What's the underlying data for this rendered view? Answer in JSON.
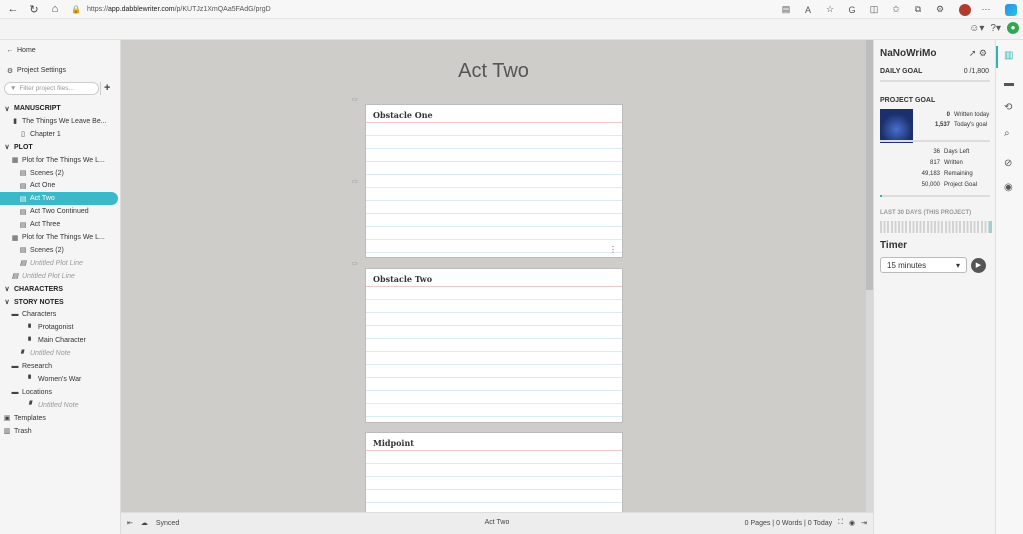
{
  "browser": {
    "url_prefix": "https://",
    "url_host": "app.dabblewriter.com",
    "url_path": "/p/KUTJz1XmQAa5FAdG/prgD"
  },
  "sidebar": {
    "home": "Home",
    "settings": "Project Settings",
    "filter_placeholder": "Filter project files...",
    "add": "+",
    "rows": [
      {
        "label": "MANUSCRIPT",
        "indent": 0,
        "kind": "sec",
        "icon": "v"
      },
      {
        "label": "The Things We Leave Be...",
        "indent": 1,
        "kind": "item",
        "icon": "book"
      },
      {
        "label": "Chapter 1",
        "indent": 2,
        "kind": "item",
        "icon": "chapter"
      },
      {
        "label": "PLOT",
        "indent": 0,
        "kind": "sec",
        "icon": "v"
      },
      {
        "label": "Plot for The Things We L...",
        "indent": 1,
        "kind": "item",
        "icon": "grid"
      },
      {
        "label": "Scenes  (2)",
        "indent": 2,
        "kind": "item",
        "icon": "line"
      },
      {
        "label": "Act One",
        "indent": 2,
        "kind": "item",
        "icon": "line"
      },
      {
        "label": "Act Two",
        "indent": 2,
        "kind": "active",
        "icon": "line"
      },
      {
        "label": "Act Two Continued",
        "indent": 2,
        "kind": "item",
        "icon": "line"
      },
      {
        "label": "Act Three",
        "indent": 2,
        "kind": "item",
        "icon": "line"
      },
      {
        "label": "Plot for The Things We L...",
        "indent": 1,
        "kind": "item",
        "icon": "grid"
      },
      {
        "label": "Scenes  (2)",
        "indent": 2,
        "kind": "item",
        "icon": "line"
      },
      {
        "label": "Untitled Plot Line",
        "indent": 2,
        "kind": "muted",
        "icon": "line"
      },
      {
        "label": "Untitled Plot Line",
        "indent": 1,
        "kind": "muted",
        "icon": "line"
      },
      {
        "label": "CHARACTERS",
        "indent": 0,
        "kind": "sec",
        "icon": "v"
      },
      {
        "label": "STORY NOTES",
        "indent": 0,
        "kind": "sec",
        "icon": "v"
      },
      {
        "label": "Characters",
        "indent": 1,
        "kind": "item",
        "icon": "folder"
      },
      {
        "label": "Protagonist",
        "indent": 3,
        "kind": "item",
        "icon": "note"
      },
      {
        "label": "Main Character",
        "indent": 3,
        "kind": "item",
        "icon": "note"
      },
      {
        "label": "Untitled Note",
        "indent": 2,
        "kind": "muted",
        "icon": "note"
      },
      {
        "label": "Research",
        "indent": 1,
        "kind": "item",
        "icon": "folder"
      },
      {
        "label": "Women's War",
        "indent": 3,
        "kind": "item",
        "icon": "note"
      },
      {
        "label": "Locations",
        "indent": 1,
        "kind": "item",
        "icon": "folder"
      },
      {
        "label": "Untitled Note",
        "indent": 3,
        "kind": "muted",
        "icon": "note"
      },
      {
        "label": "Templates",
        "indent": 0,
        "kind": "item",
        "icon": "template"
      },
      {
        "label": "Trash",
        "indent": 0,
        "kind": "item",
        "icon": "trash"
      }
    ]
  },
  "main": {
    "title": "Act Two",
    "cards": [
      {
        "title": "Obstacle One"
      },
      {
        "title": "Obstacle Two"
      },
      {
        "title": "Midpoint"
      }
    ]
  },
  "status": {
    "synced": "Synced",
    "doc": "Act Two",
    "counts": "0 Pages | 0 Words | 0 Today"
  },
  "goals": {
    "title": "NaNoWriMo",
    "daily_label": "DAILY GOAL",
    "daily_value": "0 /1,800",
    "project_label": "PROJECT GOAL",
    "written_today_num": "0",
    "written_today_lbl": "Written today",
    "todays_goal_num": "1,537",
    "todays_goal_lbl": "Today's goal",
    "days_left_num": "36",
    "days_left_lbl": "Days Left",
    "written_num": "817",
    "written_lbl": "Written",
    "remaining_num": "49,183",
    "remaining_lbl": "Remaining",
    "project_goal_num": "50,000",
    "project_goal_lbl": "Project Goal",
    "project_progress": 0.016,
    "last30": "LAST 30 DAYS (THIS PROJECT)",
    "timer_label": "Timer",
    "timer_value": "15 minutes"
  }
}
